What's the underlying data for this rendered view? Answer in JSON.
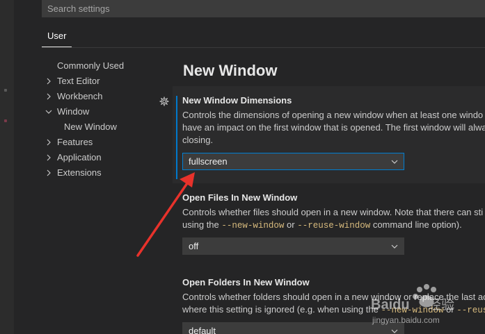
{
  "search": {
    "placeholder": "Search settings"
  },
  "tabs": [
    {
      "label": "User"
    }
  ],
  "toc": {
    "items": [
      {
        "label": "Commonly Used",
        "chevron": "none"
      },
      {
        "label": "Text Editor",
        "chevron": "right"
      },
      {
        "label": "Workbench",
        "chevron": "right"
      },
      {
        "label": "Window",
        "chevron": "down"
      },
      {
        "label": "New Window",
        "chevron": "none",
        "child": true
      },
      {
        "label": "Features",
        "chevron": "right"
      },
      {
        "label": "Application",
        "chevron": "right"
      },
      {
        "label": "Extensions",
        "chevron": "right"
      }
    ]
  },
  "section": {
    "title": "New Window"
  },
  "settings": [
    {
      "title": "New Window Dimensions",
      "desc_line1": "Controls the dimensions of opening a new window when at least one windo",
      "desc_line2": "have an impact on the first window that is opened. The first window will alwa",
      "desc_line3": "closing.",
      "value": "fullscreen"
    },
    {
      "title": "Open Files In New Window",
      "desc_line1": "Controls whether files should open in a new window. Note that there can sti",
      "desc_line2_pre": "using the ",
      "desc_line2_code1": "--new-window",
      "desc_line2_mid": " or ",
      "desc_line2_code2": "--reuse-window",
      "desc_line2_post": " command line option).",
      "value": "off"
    },
    {
      "title": "Open Folders In New Window",
      "desc_line1": "Controls whether folders should open in a new window or replace the last ac",
      "desc_line2_pre": "where this setting is ignored (e.g. when using the ",
      "desc_line2_code1": "--new-window",
      "desc_line2_mid": " or ",
      "desc_line2_code2": "--reuse",
      "value": "default"
    }
  ],
  "colors": {
    "accent": "#007acc",
    "annotation_arrow": "#e8322b"
  },
  "watermark": {
    "brand": "Baidu",
    "cn": "经验",
    "url": "jingyan.baidu.com"
  }
}
